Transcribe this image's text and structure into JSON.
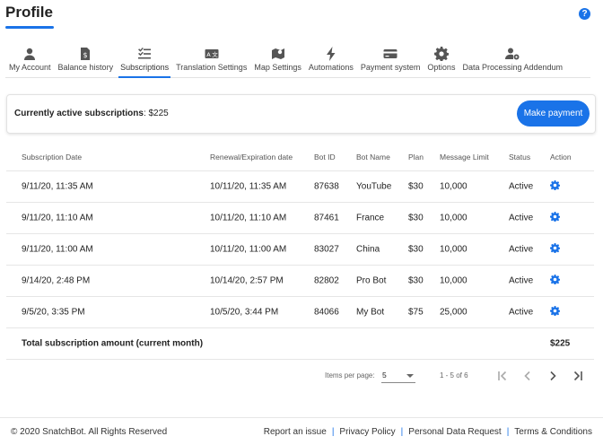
{
  "header": {
    "title": "Profile",
    "help_icon": "question-icon"
  },
  "tabs": [
    {
      "label": "My Account",
      "icon": "user-icon",
      "active": false
    },
    {
      "label": "Balance history",
      "icon": "invoice-icon",
      "active": false
    },
    {
      "label": "Subscriptions",
      "icon": "checklist-icon",
      "active": true
    },
    {
      "label": "Translation Settings",
      "icon": "translate-icon",
      "active": false
    },
    {
      "label": "Map Settings",
      "icon": "map-icon",
      "active": false
    },
    {
      "label": "Automations",
      "icon": "bolt-icon",
      "active": false
    },
    {
      "label": "Payment system",
      "icon": "credit-card-icon",
      "active": false
    },
    {
      "label": "Options",
      "icon": "gear-icon",
      "active": false
    },
    {
      "label": "Data Processing Addendum",
      "icon": "user-gear-icon",
      "active": false
    }
  ],
  "active": {
    "label": "Currently active subscriptions",
    "amount": ": $225",
    "button": "Make payment"
  },
  "table": {
    "headers": [
      "Subscription Date",
      "Renewal/Expiration date",
      "Bot ID",
      "Bot Name",
      "Plan",
      "Message Limit",
      "Status",
      "Action"
    ],
    "rows": [
      [
        "9/11/20, 11:35 AM",
        "10/11/20, 11:35 AM",
        "87638",
        "YouTube",
        "$30",
        "10,000",
        "Active"
      ],
      [
        "9/11/20, 11:10 AM",
        "10/11/20, 11:10 AM",
        "87461",
        "France",
        "$30",
        "10,000",
        "Active"
      ],
      [
        "9/11/20, 11:00 AM",
        "10/11/20, 11:00 AM",
        "83027",
        "China",
        "$30",
        "10,000",
        "Active"
      ],
      [
        "9/14/20, 2:48 PM",
        "10/14/20, 2:57 PM",
        "82802",
        "Pro Bot",
        "$30",
        "10,000",
        "Active"
      ],
      [
        "9/5/20, 3:35 PM",
        "10/5/20, 3:44 PM",
        "84066",
        "My Bot",
        "$75",
        "25,000",
        "Active"
      ]
    ],
    "total_label": "Total subscription amount (current month)",
    "total_value": "$225"
  },
  "pagination": {
    "items_per_page_label": "Items per page:",
    "items_per_page": "5",
    "range": "1 - 5 of 6"
  },
  "footer": {
    "copyright": "© 2020 SnatchBot. All Rights Reserved",
    "links": [
      "Report an issue",
      "Privacy Policy",
      "Personal Data Request",
      "Terms & Conditions"
    ]
  },
  "colors": {
    "accent": "#1a73e8"
  }
}
